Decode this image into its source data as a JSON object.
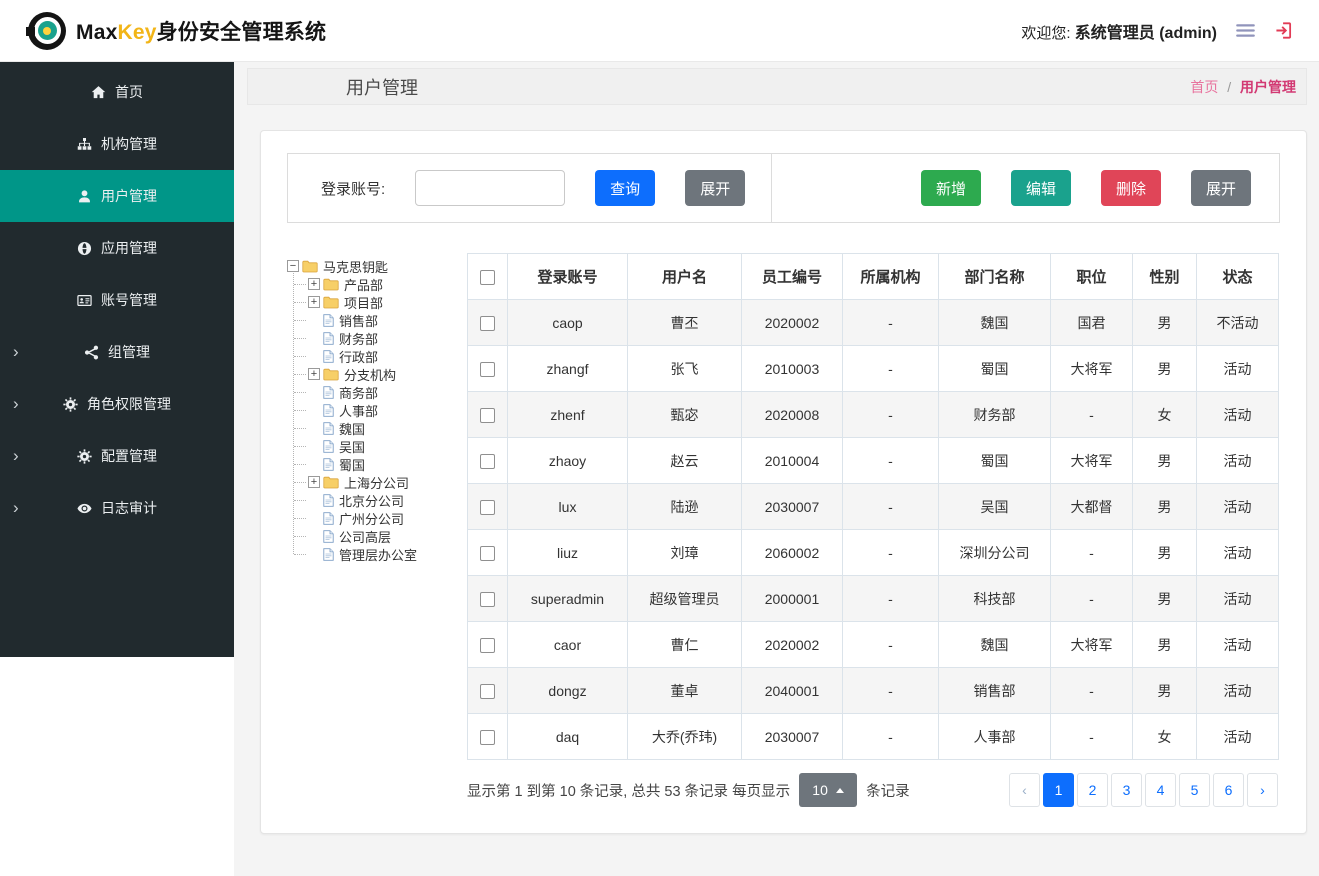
{
  "header": {
    "brand_max": "Max",
    "brand_key": "Key",
    "brand_suffix": "身份安全管理系统",
    "welcome_prefix": "欢迎您:",
    "welcome_user": "系统管理员 (admin)"
  },
  "sidebar": {
    "items": [
      {
        "name": "home",
        "label": "首页",
        "icon": "home-icon",
        "active": false,
        "chevron": false
      },
      {
        "name": "org-management",
        "label": "机构管理",
        "icon": "sitemap-icon",
        "active": false,
        "chevron": false
      },
      {
        "name": "user-management",
        "label": "用户管理",
        "icon": "user-icon",
        "active": true,
        "chevron": false
      },
      {
        "name": "app-management",
        "label": "应用管理",
        "icon": "globe-icon",
        "active": false,
        "chevron": false
      },
      {
        "name": "account-management",
        "label": "账号管理",
        "icon": "idcard-icon",
        "active": false,
        "chevron": false
      },
      {
        "name": "group-management",
        "label": "组管理",
        "icon": "share-icon",
        "active": false,
        "chevron": true
      },
      {
        "name": "role-permission",
        "label": "角色权限管理",
        "icon": "gears-icon",
        "active": false,
        "chevron": true
      },
      {
        "name": "config-management",
        "label": "配置管理",
        "icon": "gears-icon",
        "active": false,
        "chevron": true
      },
      {
        "name": "log-audit",
        "label": "日志审计",
        "icon": "eye-icon",
        "active": false,
        "chevron": true
      }
    ]
  },
  "page": {
    "title": "用户管理",
    "breadcrumb_home": "首页",
    "breadcrumb_sep": "/",
    "breadcrumb_current": "用户管理"
  },
  "toolbar": {
    "search_label": "登录账号:",
    "search_value": "",
    "query_label": "查询",
    "expand_label": "展开",
    "add_label": "新增",
    "edit_label": "编辑",
    "delete_label": "删除",
    "expand_actions_label": "展开"
  },
  "tree": {
    "nodes": [
      {
        "label": "马克思钥匙",
        "level": 0,
        "expander": "minus",
        "icon": "folder"
      },
      {
        "label": "产品部",
        "level": 1,
        "expander": "plus",
        "icon": "folder"
      },
      {
        "label": "项目部",
        "level": 1,
        "expander": "plus",
        "icon": "folder"
      },
      {
        "label": "销售部",
        "level": 1,
        "expander": "none",
        "icon": "file"
      },
      {
        "label": "财务部",
        "level": 1,
        "expander": "none",
        "icon": "file"
      },
      {
        "label": "行政部",
        "level": 1,
        "expander": "none",
        "icon": "file"
      },
      {
        "label": "分支机构",
        "level": 1,
        "expander": "plus",
        "icon": "folder"
      },
      {
        "label": "商务部",
        "level": 1,
        "expander": "none",
        "icon": "file"
      },
      {
        "label": "人事部",
        "level": 1,
        "expander": "none",
        "icon": "file"
      },
      {
        "label": "魏国",
        "level": 1,
        "expander": "none",
        "icon": "file"
      },
      {
        "label": "吴国",
        "level": 1,
        "expander": "none",
        "icon": "file"
      },
      {
        "label": "蜀国",
        "level": 1,
        "expander": "none",
        "icon": "file"
      },
      {
        "label": "上海分公司",
        "level": 1,
        "expander": "plus",
        "icon": "folder"
      },
      {
        "label": "北京分公司",
        "level": 1,
        "expander": "none",
        "icon": "file"
      },
      {
        "label": "广州分公司",
        "level": 1,
        "expander": "none",
        "icon": "file"
      },
      {
        "label": "公司高层",
        "level": 1,
        "expander": "none",
        "icon": "file"
      },
      {
        "label": "管理层办公室",
        "level": 1,
        "expander": "none",
        "icon": "file"
      }
    ]
  },
  "table": {
    "columns": [
      "登录账号",
      "用户名",
      "员工编号",
      "所属机构",
      "部门名称",
      "职位",
      "性别",
      "状态"
    ],
    "rows": [
      [
        "caop",
        "曹丕",
        "2020002",
        "-",
        "魏国",
        "国君",
        "男",
        "不活动"
      ],
      [
        "zhangf",
        "张飞",
        "2010003",
        "-",
        "蜀国",
        "大将军",
        "男",
        "活动"
      ],
      [
        "zhenf",
        "甄宓",
        "2020008",
        "-",
        "财务部",
        "-",
        "女",
        "活动"
      ],
      [
        "zhaoy",
        "赵云",
        "2010004",
        "-",
        "蜀国",
        "大将军",
        "男",
        "活动"
      ],
      [
        "lux",
        "陆逊",
        "2030007",
        "-",
        "吴国",
        "大都督",
        "男",
        "活动"
      ],
      [
        "liuz",
        "刘璋",
        "2060002",
        "-",
        "深圳分公司",
        "-",
        "男",
        "活动"
      ],
      [
        "superadmin",
        "超级管理员",
        "2000001",
        "-",
        "科技部",
        "-",
        "男",
        "活动"
      ],
      [
        "caor",
        "曹仁",
        "2020002",
        "-",
        "魏国",
        "大将军",
        "男",
        "活动"
      ],
      [
        "dongz",
        "董卓",
        "2040001",
        "-",
        "销售部",
        "-",
        "男",
        "活动"
      ],
      [
        "daq",
        "大乔(乔玮)",
        "2030007",
        "-",
        "人事部",
        "-",
        "女",
        "活动"
      ]
    ]
  },
  "pagination": {
    "summary_prefix": "显示第 1 到第 10 条记录, 总共 53 条记录 每页显示",
    "page_size": "10",
    "records_suffix": "条记录",
    "prev_label": "‹",
    "next_label": "›",
    "pages": [
      "1",
      "2",
      "3",
      "4",
      "5",
      "6"
    ],
    "active_page": "1"
  },
  "colors": {
    "primary_blue": "#0d6efd",
    "add_green": "#2daa4f",
    "edit_teal": "#1aa28d",
    "delete_red": "#e04558",
    "neutral_gray": "#6e757c",
    "sidebar_bg": "#212a2e",
    "sidebar_active_teal": "#009688",
    "brand_key_yellow": "#f2b518",
    "breadcrumb_pink": "#e8739e",
    "breadcrumb_active_pink": "#d23973",
    "logout_red": "#e23b55"
  }
}
